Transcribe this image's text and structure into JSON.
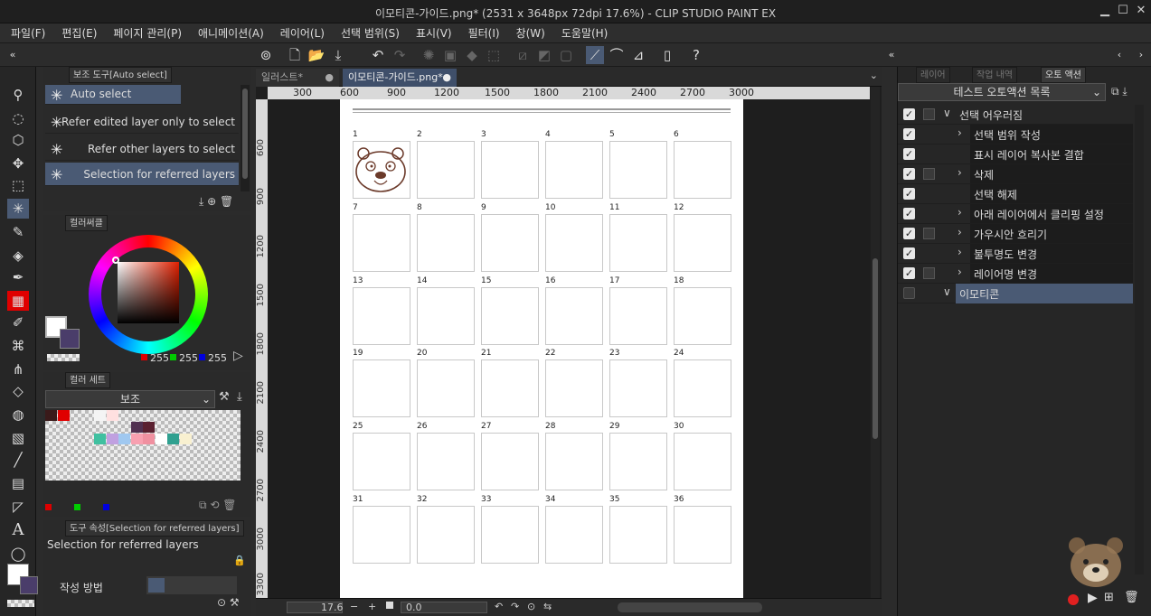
{
  "window": {
    "title": "이모티콘-가이드.png* (2531 x 3648px 72dpi 17.6%)  - CLIP STUDIO PAINT EX",
    "minimize": "▁",
    "maximize": "☐",
    "close": "✕"
  },
  "menu": [
    "파일(F)",
    "편집(E)",
    "페이지 관리(P)",
    "애니메이션(A)",
    "레이어(L)",
    "선택 범위(S)",
    "표시(V)",
    "필터(I)",
    "창(W)",
    "도움말(H)"
  ],
  "sub_tool": {
    "tab_label": "보조 도구[Auto select]",
    "header": "Auto select",
    "items": [
      {
        "label": "Refer edited layer only to select",
        "selected": false
      },
      {
        "label": "Refer other layers to select",
        "selected": false
      },
      {
        "label": "Selection for referred layers",
        "selected": true
      }
    ]
  },
  "color_panel": {
    "tab_label": "컬러써클",
    "r": "255",
    "g": "255",
    "b": "255",
    "main_color": "#ffffff",
    "sub_color": "#4a3d6a"
  },
  "color_set": {
    "tab_label": "컬러 세트",
    "set_name": "보조",
    "swatches": [
      "#3a1a1a",
      "#e00000",
      "#f4f4f4",
      "#ffe0e0",
      "#f8a0b0",
      "#5a2030",
      "#40c0a0",
      "#c0a0e0",
      "#a0c8f0",
      "#503050",
      "#f090a0",
      "#ffffff",
      "#30a090",
      "#f8f0d0"
    ]
  },
  "tool_property": {
    "tab_label": "도구 속성[Selection for referred layers]",
    "name": "Selection for referred layers",
    "method_label": "작성 방법"
  },
  "doc_tabs": [
    {
      "label": "일러스트*",
      "active": false
    },
    {
      "label": "이모티콘-가이드.png*",
      "active": true
    }
  ],
  "ruler_h": [
    "300",
    "600",
    "900",
    "1200",
    "1500",
    "1800",
    "2100",
    "2400",
    "2700",
    "3000"
  ],
  "ruler_v": [
    "600",
    "900",
    "1200",
    "1500",
    "1800",
    "2100",
    "2400",
    "2700",
    "3000",
    "3300"
  ],
  "grid_numbers": [
    "1",
    "2",
    "3",
    "4",
    "5",
    "6",
    "7",
    "8",
    "9",
    "10",
    "11",
    "12",
    "13",
    "14",
    "15",
    "16",
    "17",
    "18",
    "19",
    "20",
    "21",
    "22",
    "23",
    "24",
    "25",
    "26",
    "27",
    "28",
    "29",
    "30",
    "31",
    "32",
    "33",
    "34",
    "35",
    "36"
  ],
  "status": {
    "zoom": "17.6",
    "angle": "0.0"
  },
  "right_panel": {
    "tabs": [
      "레이어",
      "작업 내역",
      "오토 액션"
    ],
    "set_name": "테스트 오토액션 목록",
    "rows": [
      {
        "label": "선택 어우러짐",
        "level": 0,
        "checked": true,
        "expanded": true,
        "has_box": true,
        "has_chevron": true,
        "selected": false
      },
      {
        "label": "선택 범위 작성",
        "level": 1,
        "checked": true,
        "has_box": false,
        "has_chevron": true,
        "selected": false
      },
      {
        "label": "표시 레이어 복사본 결합",
        "level": 1,
        "checked": true,
        "has_box": false,
        "has_chevron": false,
        "selected": false
      },
      {
        "label": "삭제",
        "level": 1,
        "checked": true,
        "has_box": true,
        "has_chevron": true,
        "selected": false
      },
      {
        "label": "선택 해제",
        "level": 1,
        "checked": true,
        "has_box": false,
        "has_chevron": false,
        "selected": false
      },
      {
        "label": "아래 레이어에서 클리핑 설정",
        "level": 1,
        "checked": true,
        "has_box": false,
        "has_chevron": true,
        "selected": false
      },
      {
        "label": "가우시안 흐리기",
        "level": 1,
        "checked": true,
        "has_box": true,
        "has_chevron": true,
        "selected": false
      },
      {
        "label": "불투명도 변경",
        "level": 1,
        "checked": true,
        "has_box": false,
        "has_chevron": true,
        "selected": false
      },
      {
        "label": "레이어명 변경",
        "level": 1,
        "checked": true,
        "has_box": true,
        "has_chevron": true,
        "selected": false
      },
      {
        "label": "이모티콘",
        "level": 0,
        "checked": false,
        "expanded": true,
        "has_box": false,
        "has_chevron": true,
        "selected": true
      }
    ]
  },
  "colors": {
    "accent": "#4a5a74",
    "record": "#e02020"
  }
}
